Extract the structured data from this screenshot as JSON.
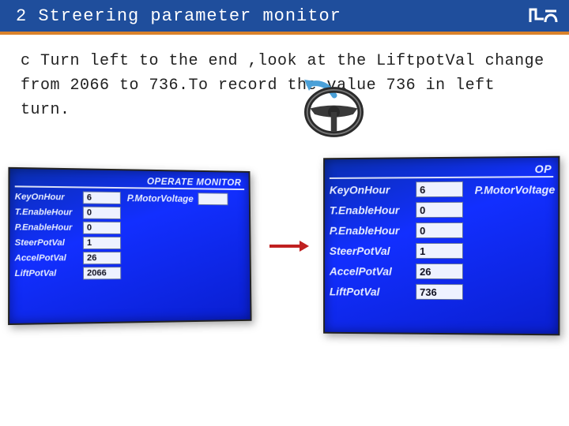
{
  "header": {
    "title": "2 Streering parameter monitor"
  },
  "instruction": {
    "text": "c Turn left to the end ,look at the LiftpotVal change from 2066 to 736.To record the value 736 in left turn."
  },
  "monitor_left": {
    "title": "OPERATE MONITOR",
    "rows": [
      {
        "label": "KeyOnHour",
        "value": "6"
      },
      {
        "label": "T.EnableHour",
        "value": "0"
      },
      {
        "label": "P.EnableHour",
        "value": "0"
      },
      {
        "label": "SteerPotVal",
        "value": "1"
      },
      {
        "label": "AccelPotVal",
        "value": "26"
      },
      {
        "label": "LiftPotVal",
        "value": "2066"
      }
    ],
    "side_label": "P.MotorVoltage"
  },
  "monitor_right": {
    "title_partial": "OP",
    "rows": [
      {
        "label": "KeyOnHour",
        "value": "6"
      },
      {
        "label": "T.EnableHour",
        "value": "0"
      },
      {
        "label": "P.EnableHour",
        "value": "0"
      },
      {
        "label": "SteerPotVal",
        "value": "1"
      },
      {
        "label": "AccelPotVal",
        "value": "26"
      },
      {
        "label": "LiftPotVal",
        "value": "736"
      }
    ],
    "side_label": "P.MotorVoltage"
  }
}
